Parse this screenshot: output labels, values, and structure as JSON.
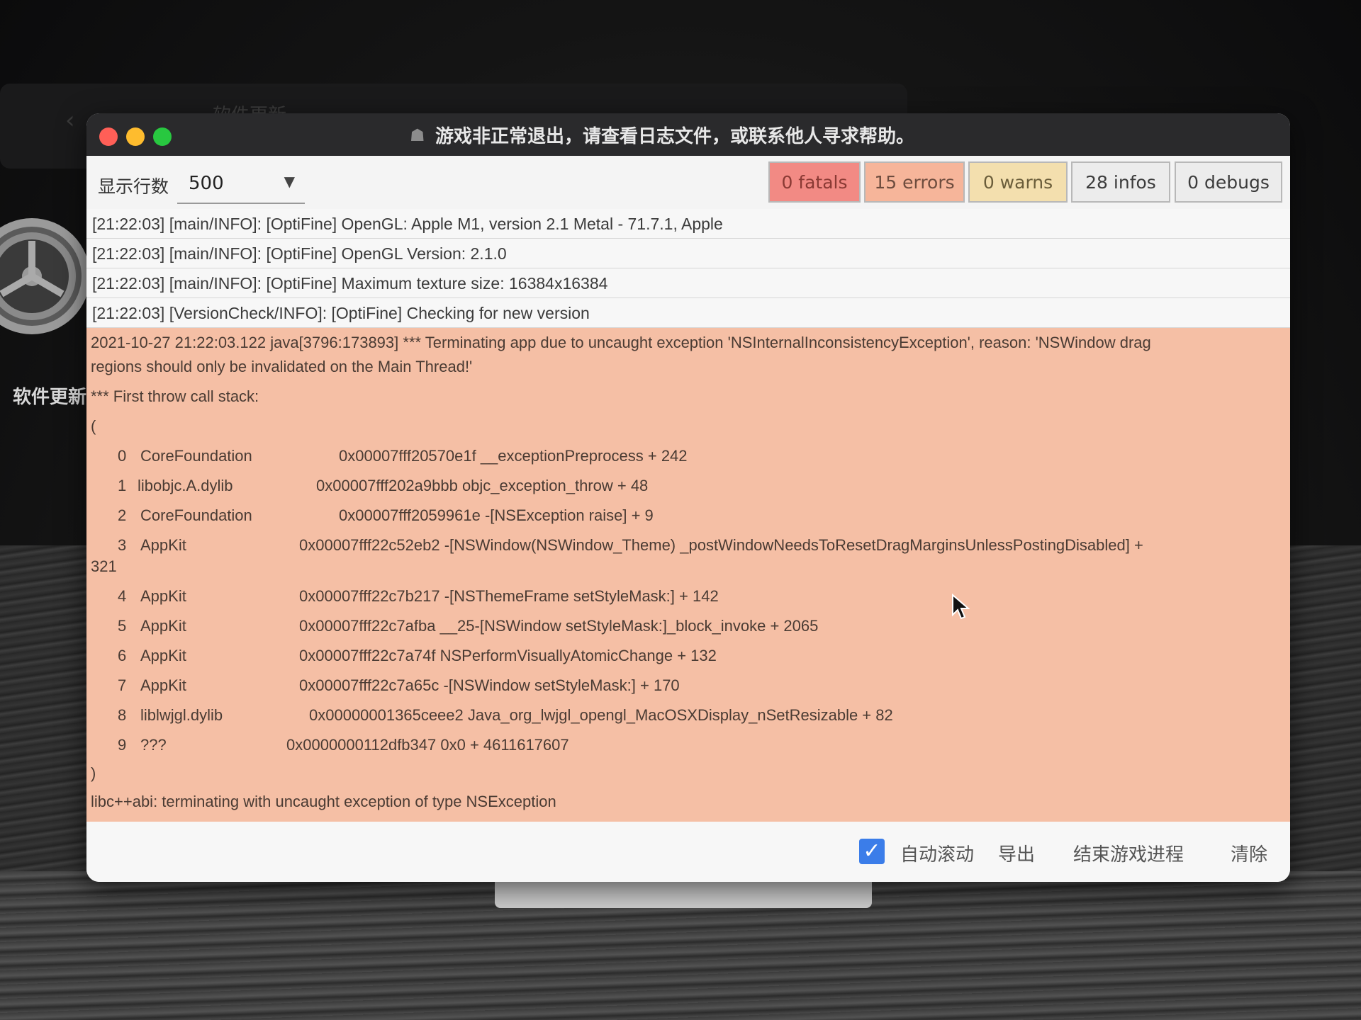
{
  "background": {
    "window_title": "软件更新",
    "desktop_label": "软件更新"
  },
  "window": {
    "title": "游戏非正常退出，请查看日志文件，或联系他人寻求帮助。"
  },
  "toolbar": {
    "rows_label": "显示行数",
    "rows_value": "500",
    "filters": {
      "fatals": "0 fatals",
      "errors": "15 errors",
      "warns": "0 warns",
      "infos": "28 infos",
      "debugs": "0 debugs"
    }
  },
  "log": {
    "info_rows": [
      "[21:22:03] [main/INFO]: [OptiFine] OpenGL: Apple M1, version 2.1 Metal - 71.7.1, Apple",
      "[21:22:03] [main/INFO]: [OptiFine] OpenGL Version: 2.1.0",
      "[21:22:03] [main/INFO]: [OptiFine] Maximum texture size: 16384x16384",
      "[21:22:03] [VersionCheck/INFO]: [OptiFine] Checking for new version"
    ],
    "error": {
      "line1": "2021-10-27 21:22:03.122 java[3796:173893] *** Terminating app due to uncaught exception 'NSInternalInconsistencyException', reason: 'NSWindow drag",
      "line2": "regions should only be invalidated on the Main Thread!'",
      "line3": "*** First throw call stack:",
      "open_paren": "(",
      "close_paren": ")",
      "last_line": "libc++abi: terminating with uncaught exception of type NSException",
      "stack": [
        {
          "idx": "0",
          "lib": "CoreFoundation",
          "addr": "0x00007fff20570e1f __exceptionPreprocess + 242"
        },
        {
          "idx": "1",
          "lib": "libobjc.A.dylib",
          "addr": "0x00007fff202a9bbb objc_exception_throw + 48"
        },
        {
          "idx": "2",
          "lib": "CoreFoundation",
          "addr": "0x00007fff2059961e -[NSException raise] + 9"
        },
        {
          "idx": "3",
          "lib": "AppKit",
          "addr": "0x00007fff22c52eb2 -[NSWindow(NSWindow_Theme) _postWindowNeedsToResetDragMarginsUnlessPostingDisabled] +",
          "cont": "321"
        },
        {
          "idx": "4",
          "lib": "AppKit",
          "addr": "0x00007fff22c7b217 -[NSThemeFrame setStyleMask:] + 142"
        },
        {
          "idx": "5",
          "lib": "AppKit",
          "addr": "0x00007fff22c7afba __25-[NSWindow setStyleMask:]_block_invoke + 2065"
        },
        {
          "idx": "6",
          "lib": "AppKit",
          "addr": "0x00007fff22c7a74f NSPerformVisuallyAtomicChange + 132"
        },
        {
          "idx": "7",
          "lib": "AppKit",
          "addr": "0x00007fff22c7a65c -[NSWindow setStyleMask:] + 170"
        },
        {
          "idx": "8",
          "lib": "liblwjgl.dylib",
          "addr": "0x00000001365ceee2 Java_org_lwjgl_opengl_MacOSXDisplay_nSetResizable + 82"
        },
        {
          "idx": "9",
          "lib": "???",
          "addr": "0x0000000112dfb347 0x0 + 4611617607"
        }
      ]
    }
  },
  "bottom": {
    "autoscroll_label": "自动滚动",
    "autoscroll_checked": true,
    "export_label": "导出",
    "kill_label": "结束游戏进程",
    "clear_label": "清除"
  },
  "colors": {
    "fatal": "#f28a84",
    "error": "#f6b59a",
    "warn": "#f3dfae",
    "error_block": "#f5bfa5",
    "checkbox": "#3b7de9"
  }
}
